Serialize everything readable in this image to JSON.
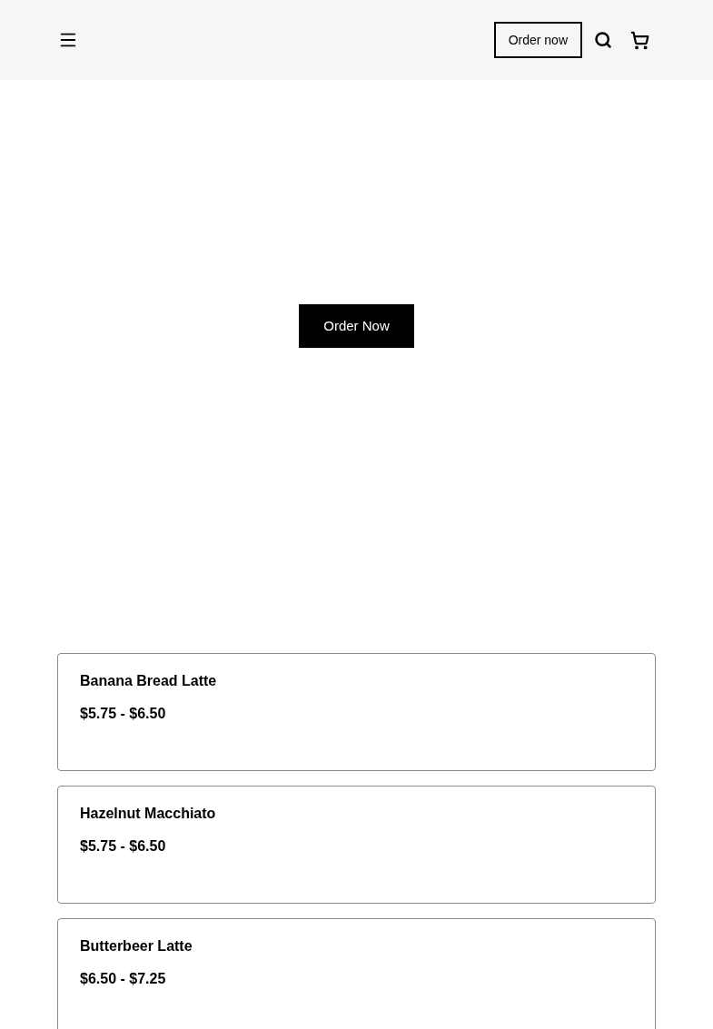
{
  "header": {
    "order_button": "Order now"
  },
  "hero": {
    "button": "Order Now"
  },
  "products": [
    {
      "name": "Banana Bread Latte",
      "price": "$5.75 - $6.50"
    },
    {
      "name": "Hazelnut Macchiato",
      "price": "$5.75 - $6.50"
    },
    {
      "name": "Butterbeer Latte",
      "price": "$6.50 - $7.25"
    }
  ]
}
